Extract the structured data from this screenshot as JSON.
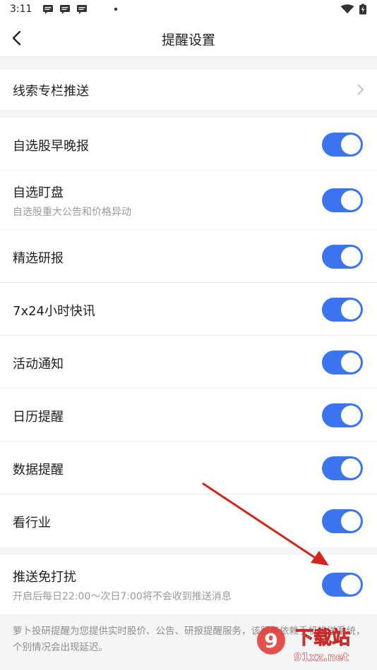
{
  "status_bar": {
    "time": "3:11"
  },
  "nav": {
    "title": "提醒设置"
  },
  "groups": {
    "clue": {
      "label": "线索专栏推送"
    },
    "items": [
      {
        "label": "自选股早晚报",
        "on": true
      },
      {
        "label": "自选盯盘",
        "sub": "自选股重大公告和价格异动",
        "on": true
      },
      {
        "label": "精选研报",
        "on": true
      },
      {
        "label": "7x24小时快讯",
        "on": true
      },
      {
        "label": "活动通知",
        "on": true
      },
      {
        "label": "日历提醒",
        "on": true
      },
      {
        "label": "数据提醒",
        "on": true
      },
      {
        "label": "看行业",
        "on": true
      }
    ],
    "dnd": {
      "label": "推送免打扰",
      "sub": "开启后每日22:00～次日7:00将不会收到推送消息",
      "on": true
    }
  },
  "footer": {
    "note": "萝卜投研提醒为您提供实时股价、公告、研报提醒服务，该服务依赖手机推送系统，个别情况会出现延迟。"
  },
  "watermark": {
    "text": "下载站",
    "domain": "91xz.net"
  },
  "colors": {
    "toggle_on": "#3a74ef",
    "arrow": "#d0241c"
  }
}
